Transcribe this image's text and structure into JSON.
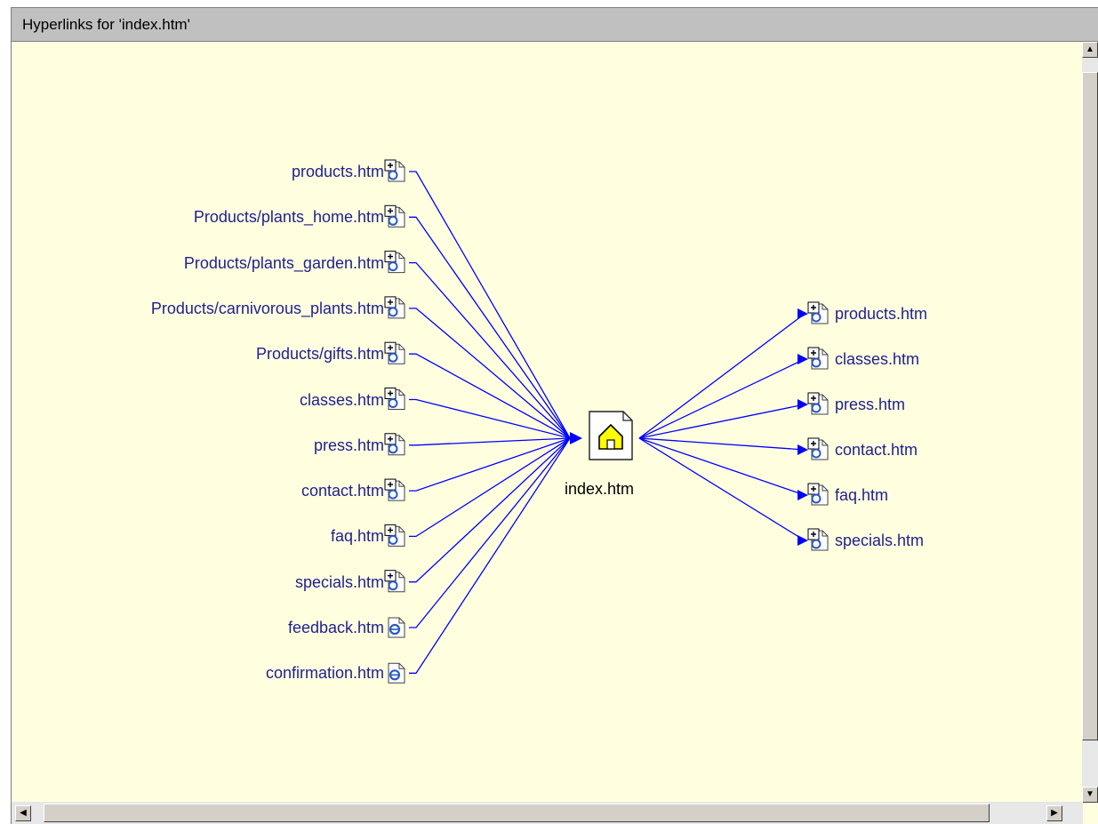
{
  "window": {
    "title": "Hyperlinks for 'index.htm'"
  },
  "center": {
    "label": "index.htm",
    "icon": "home-page-icon"
  },
  "incoming": [
    {
      "label": "products.htm",
      "icon": "page-expand-icon"
    },
    {
      "label": "Products/plants_home.htm",
      "icon": "page-expand-icon"
    },
    {
      "label": "Products/plants_garden.htm",
      "icon": "page-expand-icon"
    },
    {
      "label": "Products/carnivorous_plants.htm",
      "icon": "page-expand-icon"
    },
    {
      "label": "Products/gifts.htm",
      "icon": "page-expand-icon"
    },
    {
      "label": "classes.htm",
      "icon": "page-expand-icon"
    },
    {
      "label": "press.htm",
      "icon": "page-expand-icon"
    },
    {
      "label": "contact.htm",
      "icon": "page-expand-icon"
    },
    {
      "label": "faq.htm",
      "icon": "page-expand-icon"
    },
    {
      "label": "specials.htm",
      "icon": "page-expand-icon"
    },
    {
      "label": "feedback.htm",
      "icon": "ie-page-icon"
    },
    {
      "label": "confirmation.htm",
      "icon": "ie-page-icon"
    }
  ],
  "outgoing": [
    {
      "label": "products.htm",
      "icon": "page-expand-icon"
    },
    {
      "label": "classes.htm",
      "icon": "page-expand-icon"
    },
    {
      "label": "press.htm",
      "icon": "page-expand-icon"
    },
    {
      "label": "contact.htm",
      "icon": "page-expand-icon"
    },
    {
      "label": "faq.htm",
      "icon": "page-expand-icon"
    },
    {
      "label": "specials.htm",
      "icon": "page-expand-icon"
    }
  ],
  "colors": {
    "background": "#ffffe0",
    "link_line": "#0000ff",
    "label_text": "#1f1f8f"
  }
}
